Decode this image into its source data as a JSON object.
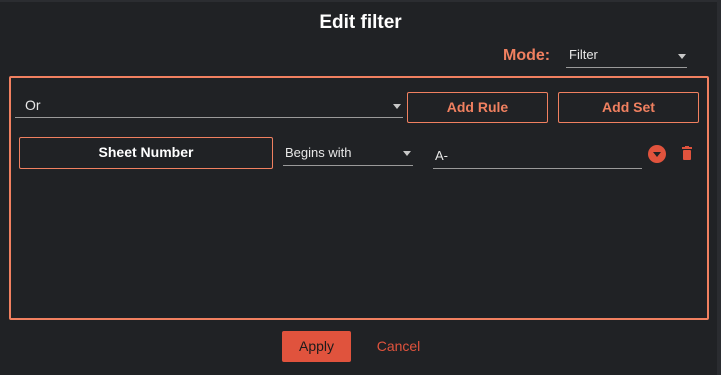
{
  "dialog": {
    "title": "Edit filter",
    "mode_label": "Mode:",
    "mode_value": "Filter"
  },
  "rule_set": {
    "logic_value": "Or",
    "add_rule_label": "Add Rule",
    "add_set_label": "Add Set"
  },
  "rule": {
    "field_label": "Sheet Number",
    "operator_value": "Begins with",
    "value": "A-"
  },
  "footer": {
    "apply_label": "Apply",
    "cancel_label": "Cancel"
  },
  "icons": {
    "mode_caret": "chevron-down-icon",
    "rule_options": "circle-chevron-down-icon",
    "delete_rule": "trash-icon"
  },
  "colors": {
    "accent": "#f08060",
    "button": "#e0533d",
    "background": "#202225"
  }
}
